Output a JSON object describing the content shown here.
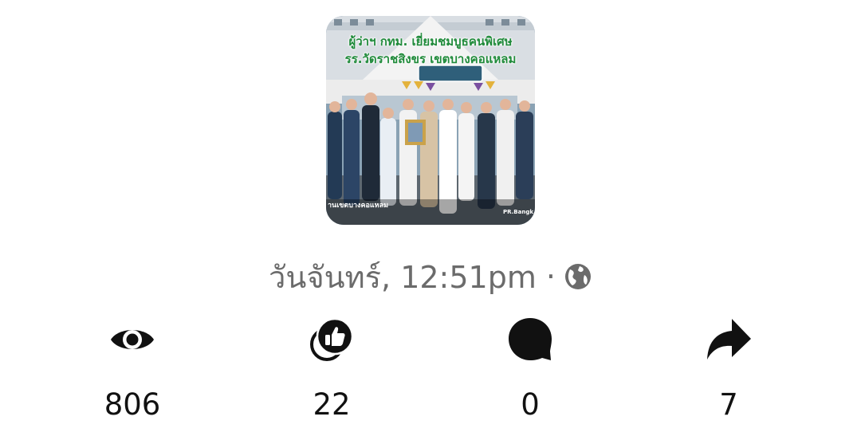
{
  "post": {
    "image": {
      "headline_line1": "ผู้ว่าฯ กทม. เยี่ยมชมบูธคนพิเศษ",
      "headline_line2": "รร.วัดราชสิงขร เขตบางคอแหลม",
      "credit_left": "านเขตบางคอแหลม",
      "credit_right": "PR.Bangk",
      "media_type_icon": "photo-icon"
    },
    "meta": {
      "timestamp": "วันจันทร์, 12:51pm",
      "separator": "·",
      "audience_icon": "globe-icon"
    }
  },
  "stats": {
    "views": {
      "icon": "eye-icon",
      "count": "806"
    },
    "reactions": {
      "icon": "like-reaction-icon",
      "count": "22"
    },
    "comments": {
      "icon": "comment-bubble-icon",
      "count": "0"
    },
    "shares": {
      "icon": "share-arrow-icon",
      "count": "7"
    }
  },
  "colors": {
    "stat_text": "#111111",
    "meta_text": "#6b6b6b",
    "headline_green": "#1f8a3a"
  }
}
